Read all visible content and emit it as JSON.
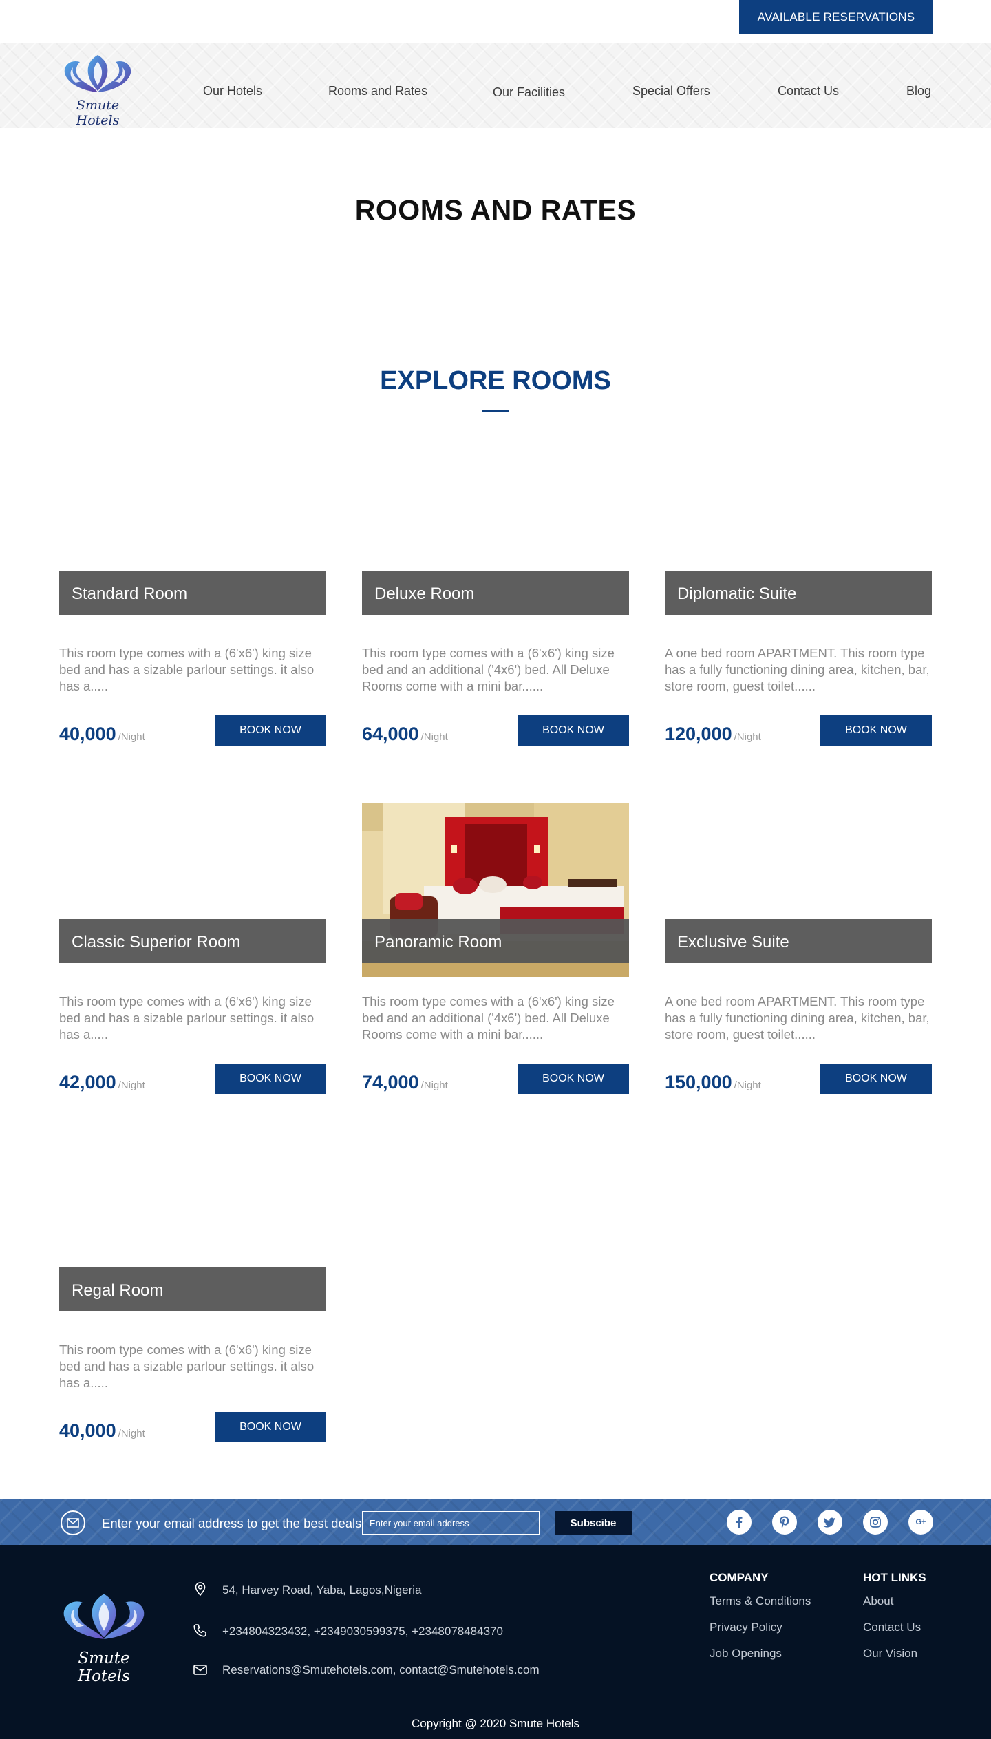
{
  "topbar": {
    "reserve_label": "AVAILABLE RESERVATIONS"
  },
  "brand": {
    "logo_text": "Smute Hotels"
  },
  "nav": [
    {
      "label": "Our Hotels"
    },
    {
      "label": "Rooms and Rates"
    },
    {
      "label": "Our Facilities"
    },
    {
      "label": "Special Offers"
    },
    {
      "label": "Contact Us"
    },
    {
      "label": "Blog"
    }
  ],
  "page_title": "ROOMS AND RATES",
  "section_title": "EXPLORE ROOMS",
  "rooms": [
    {
      "name": "Standard Room",
      "description": "This room type comes with a (6'x6') king size bed and has a sizable parlour settings. it also has a.....",
      "price": "40,000",
      "unit": "/Night",
      "button": "BOOK NOW"
    },
    {
      "name": "Deluxe Room",
      "description": "This room type comes with a (6'x6') king size bed and an additional ('4x6') bed. All Deluxe Rooms come with a mini bar......",
      "price": "64,000",
      "unit": "/Night",
      "button": "BOOK NOW"
    },
    {
      "name": "Diplomatic Suite",
      "description": "A one bed room APARTMENT. This room type has a fully functioning dining area, kitchen, bar, store room, guest toilet......",
      "price": "120,000",
      "unit": "/Night",
      "button": "BOOK NOW"
    },
    {
      "name": "Classic Superior Room",
      "description": "This room type comes with a (6'x6') king size bed and has a sizable parlour settings. it also has a.....",
      "price": "42,000",
      "unit": "/Night",
      "button": "BOOK NOW"
    },
    {
      "name": "Panoramic Room",
      "description": "This room type comes with a (6'x6') king size bed and an additional ('4x6') bed. All Deluxe Rooms come with a mini bar......",
      "price": "74,000",
      "unit": "/Night",
      "button": "BOOK NOW"
    },
    {
      "name": "Exclusive Suite",
      "description": "A one bed room APARTMENT. This room type has a fully functioning dining area, kitchen, bar, store room, guest toilet......",
      "price": "150,000",
      "unit": "/Night",
      "button": "BOOK NOW"
    },
    {
      "name": "Regal Room",
      "description": "This room type comes with a (6'x6') king size bed and has a sizable parlour settings. it also has a.....",
      "price": "40,000",
      "unit": "/Night",
      "button": "BOOK NOW"
    }
  ],
  "newsletter": {
    "text": "Enter your email address to get the best deals",
    "placeholder": "Enter your email address",
    "button": "Subscibe",
    "social": [
      "facebook-icon",
      "pinterest-icon",
      "twitter-icon",
      "instagram-icon",
      "google-plus-icon"
    ],
    "google_plus_glyph": "G+"
  },
  "footer": {
    "logo_text": "Smute Hotels",
    "address": "54, Harvey Road, Yaba, Lagos,Nigeria",
    "phones": "+234804323432, +2349030599375, +2348078484370",
    "emails": "Reservations@Smutehotels.com, contact@Smutehotels.com",
    "company": {
      "title": "COMPANY",
      "links": [
        "Terms & Conditions",
        "Privacy Policy",
        "Job Openings"
      ]
    },
    "hotlinks": {
      "title": "HOT LINKS",
      "links": [
        "About",
        "Contact Us",
        "Our Vision"
      ]
    },
    "copyright": "Copyright @ 2020 Smute Hotels"
  },
  "colors": {
    "brand_blue": "#0d3f80",
    "footer_navy": "#051224",
    "newsletter_blue": "#3d6aa8",
    "card_header_gray": "#555555"
  }
}
